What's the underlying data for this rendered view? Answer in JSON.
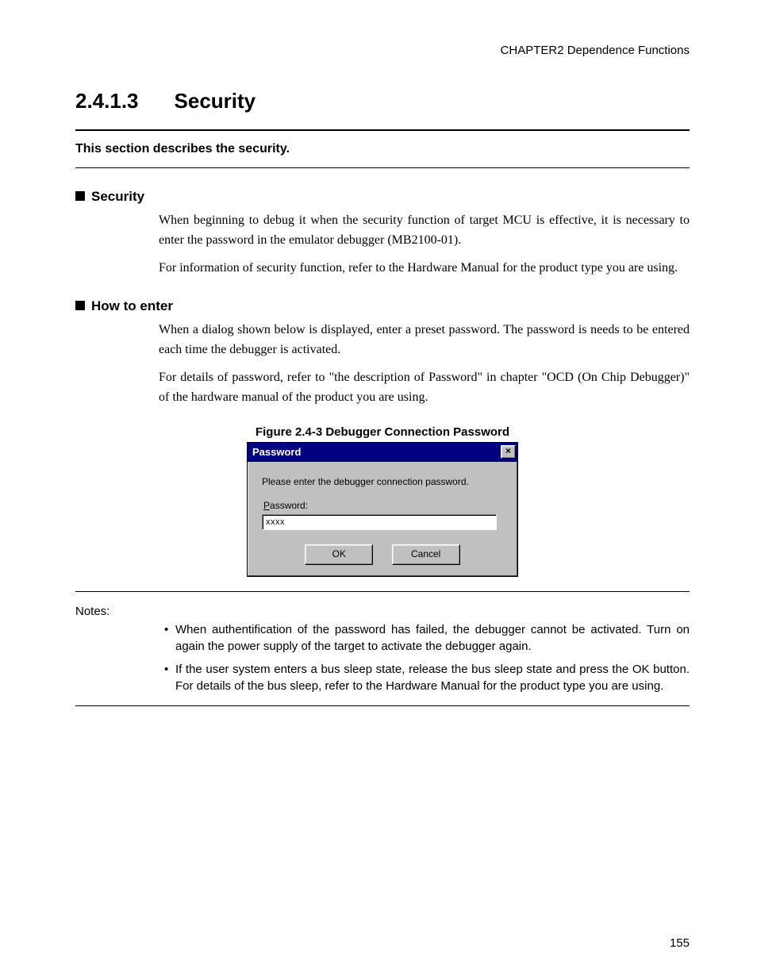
{
  "chapter_header": "CHAPTER2  Dependence Functions",
  "section": {
    "number": "2.4.1.3",
    "title": "Security"
  },
  "intro": "This section describes the security.",
  "sub_security": {
    "heading": "Security",
    "p1": "When beginning to debug it when the security function of target MCU is effective, it is necessary to enter the password in the emulator debugger (MB2100-01).",
    "p2": "For information of security function, refer to the Hardware Manual for the product type you are using."
  },
  "sub_howto": {
    "heading": "How to enter",
    "p1": "When a dialog shown below is displayed, enter a preset password. The password is needs to be entered each time the debugger is activated.",
    "p2": "For details of password, refer to \"the description of Password\" in chapter \"OCD (On Chip Debugger)\" of the hardware manual of the product you are using."
  },
  "figure_caption": "Figure 2.4-3  Debugger Connection Password",
  "dialog": {
    "title": "Password",
    "close_glyph": "×",
    "message": "Please enter the debugger connection password.",
    "label_underline": "P",
    "label_rest": "assword:",
    "input_value": "xxxx",
    "ok": "OK",
    "cancel": "Cancel"
  },
  "notes_label": "Notes:",
  "notes": [
    "When authentification of the password has failed, the debugger cannot be activated. Turn on again the power supply of the target to activate the debugger again.",
    "If the user system enters a bus sleep state, release the bus sleep state and press the OK button. For details of the bus sleep, refer to the Hardware Manual for the product type you are using."
  ],
  "page_number": "155"
}
